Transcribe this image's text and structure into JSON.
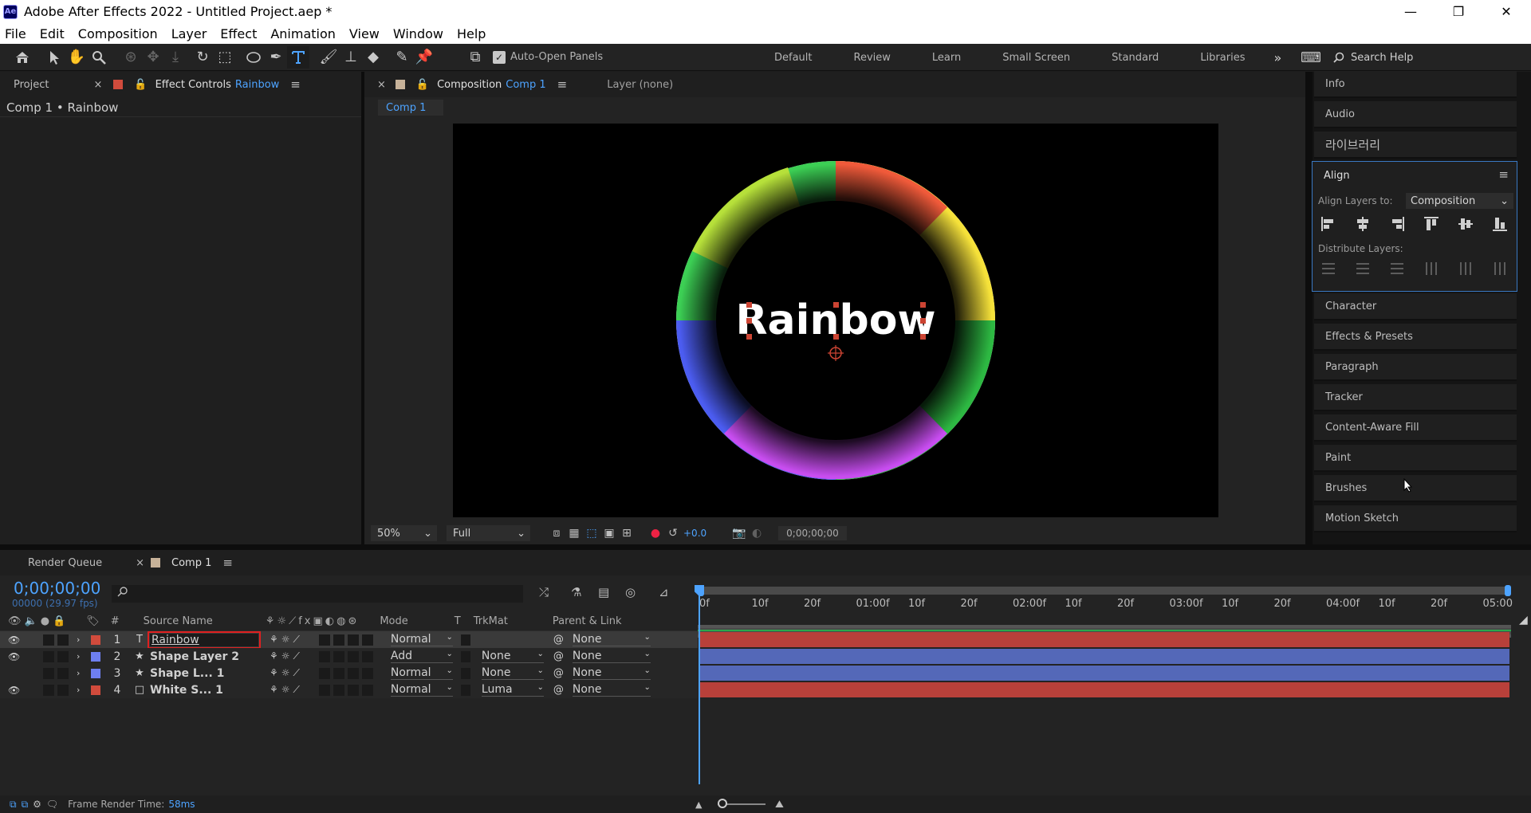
{
  "window": {
    "app_logo": "Ae",
    "title": "Adobe After Effects 2022 - Untitled Project.aep *",
    "minimize": "—",
    "restore": "❐",
    "close": "✕"
  },
  "menu": [
    "File",
    "Edit",
    "Composition",
    "Layer",
    "Effect",
    "Animation",
    "View",
    "Window",
    "Help"
  ],
  "toolbar": {
    "auto_open_panels": "Auto-Open Panels",
    "workspaces": [
      "Default",
      "Review",
      "Learn",
      "Small Screen",
      "Standard",
      "Libraries"
    ],
    "more": "»",
    "search_help": "Search Help"
  },
  "left_panel": {
    "tab_project": "Project",
    "tab_effect_controls": "Effect Controls",
    "effect_controls_layer": "Rainbow",
    "breadcrumb": "Comp 1 • Rainbow"
  },
  "comp_panel": {
    "tab_label": "Composition",
    "comp_name": "Comp 1",
    "layer_tab": "Layer (none)",
    "subtab": "Comp 1",
    "viewer_text": "Rainbow",
    "zoom": "50%",
    "resolution": "Full",
    "exposure": "+0.0",
    "timecode": "0;00;00;00"
  },
  "right_panel": {
    "info": "Info",
    "audio": "Audio",
    "libraries": "라이브러리",
    "align": "Align",
    "align_layers_to": "Align Layers to:",
    "align_target": "Composition",
    "distribute_layers": "Distribute Layers:",
    "items": [
      "Character",
      "Effects & Presets",
      "Paragraph",
      "Tracker",
      "Content-Aware Fill",
      "Paint",
      "Brushes",
      "Motion Sketch"
    ]
  },
  "timeline": {
    "tab_render_queue": "Render Queue",
    "tab_comp": "Comp 1",
    "timecode": "0;00;00;00",
    "fps": "00000 (29.97 fps)",
    "search_placeholder": "",
    "col_num": "#",
    "col_source": "Source Name",
    "col_mode": "Mode",
    "col_t": "T",
    "col_trkmat": "TrkMat",
    "col_parent": "Parent & Link",
    "ruler": [
      "0f",
      "10f",
      "20f",
      "01:00f",
      "10f",
      "20f",
      "02:00f",
      "10f",
      "20f",
      "03:00f",
      "10f",
      "20f",
      "04:00f",
      "10f",
      "20f",
      "05:00"
    ],
    "layers": [
      {
        "num": "1",
        "type": "T",
        "name": "Rainbow",
        "mode": "Normal",
        "trkmat": "",
        "parent": "None",
        "color": "#d14b3c",
        "bar": "#b8403a"
      },
      {
        "num": "2",
        "type": "★",
        "name": "Shape Layer 2",
        "mode": "Add",
        "trkmat": "None",
        "parent": "None",
        "color": "#6e7ff0",
        "bar": "#5468b8"
      },
      {
        "num": "3",
        "type": "★",
        "name": "Shape L... 1",
        "mode": "Normal",
        "trkmat": "None",
        "parent": "None",
        "color": "#6e7ff0",
        "bar": "#5468b8"
      },
      {
        "num": "4",
        "type": "□",
        "name": "White S... 1",
        "mode": "Normal",
        "trkmat": "Luma",
        "parent": "None",
        "color": "#d14b3c",
        "bar": "#b8403a"
      }
    ],
    "frame_render_label": "Frame Render Time:",
    "frame_render_value": "58ms"
  }
}
